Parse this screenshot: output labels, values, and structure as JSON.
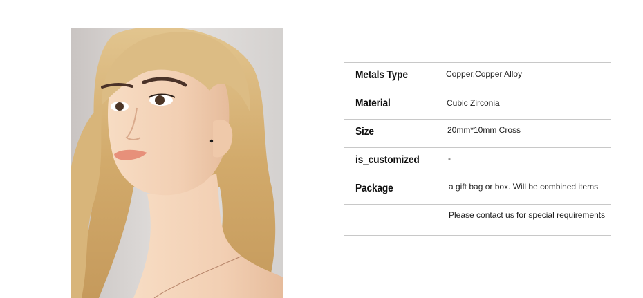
{
  "product_image": {
    "alt": "mannequin-with-stud-earring"
  },
  "specs": [
    {
      "label": "Metals Type",
      "value": "Copper,Copper Alloy"
    },
    {
      "label": "Material",
      "value": "Cubic Zirconia"
    },
    {
      "label": "Size",
      "value": "20mm*10mm Cross"
    },
    {
      "label": "is_customized",
      "value": "-"
    },
    {
      "label": "Package",
      "value": "a gift bag or box. Will be combined items"
    },
    {
      "label": "",
      "value": "Please contact us for special requirements"
    }
  ]
}
